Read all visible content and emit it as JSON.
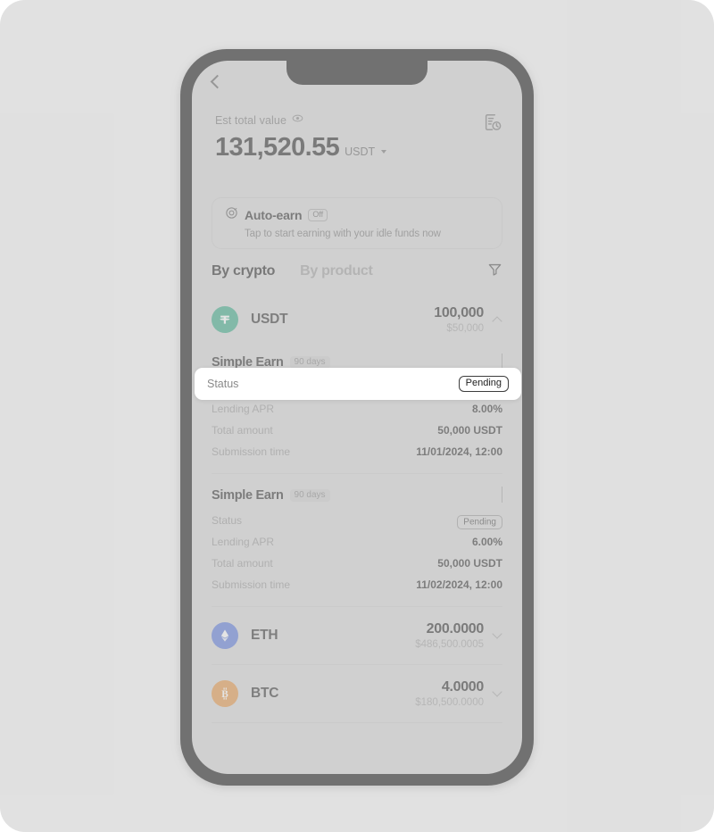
{
  "screen": {
    "back_icon": "chevron-left-icon",
    "record_icon": "order-history-icon"
  },
  "header": {
    "est_label": "Est total value",
    "eye_icon": "eye-icon",
    "total_value": "131,520.55",
    "unit": "USDT"
  },
  "auto_earn": {
    "icon": "auto-earn-target-icon",
    "title": "Auto-earn",
    "badge": "Off",
    "subtitle": "Tap to start earning with your idle funds now"
  },
  "tabs": {
    "active": "By crypto",
    "inactive": "By product",
    "filter_icon": "filter-funnel-icon"
  },
  "assets": [
    {
      "symbol": "USDT",
      "logo_color": "#26a17b",
      "logo_glyph": "T",
      "amount": "100,000",
      "fiat": "$50,000",
      "chevron": "chevron-up-icon",
      "expanded": true
    },
    {
      "symbol": "ETH",
      "logo_color": "#4a6cd4",
      "logo_glyph": "E",
      "amount": "200.0000",
      "fiat": "$486,500.0005",
      "chevron": "chevron-down-icon",
      "expanded": false
    },
    {
      "symbol": "BTC",
      "logo_color": "#e08b33",
      "logo_glyph": "B",
      "amount": "4.0000",
      "fiat": "$180,500.0000",
      "chevron": "chevron-down-icon",
      "expanded": false
    }
  ],
  "earn_products": [
    {
      "title": "Simple Earn",
      "term": "90 days",
      "arrow_icon": "chevron-right-icon",
      "rows": [
        {
          "key": "Status",
          "value": "Pending",
          "is_badge": true
        },
        {
          "key": "Lending APR",
          "value": "8.00%",
          "is_badge": false
        },
        {
          "key": "Total amount",
          "value": "50,000 USDT",
          "is_badge": false
        },
        {
          "key": "Submission time",
          "value": "11/01/2024, 12:00",
          "is_badge": false
        }
      ]
    },
    {
      "title": "Simple Earn",
      "term": "90 days",
      "arrow_icon": "chevron-right-icon",
      "rows": [
        {
          "key": "Status",
          "value": "Pending",
          "is_badge": true
        },
        {
          "key": "Lending APR",
          "value": "6.00%",
          "is_badge": false
        },
        {
          "key": "Total amount",
          "value": "50,000 USDT",
          "is_badge": false
        },
        {
          "key": "Submission time",
          "value": "11/02/2024, 12:00",
          "is_badge": false
        }
      ]
    }
  ],
  "spotlight": {
    "key": "Status",
    "badge": "Pending"
  }
}
